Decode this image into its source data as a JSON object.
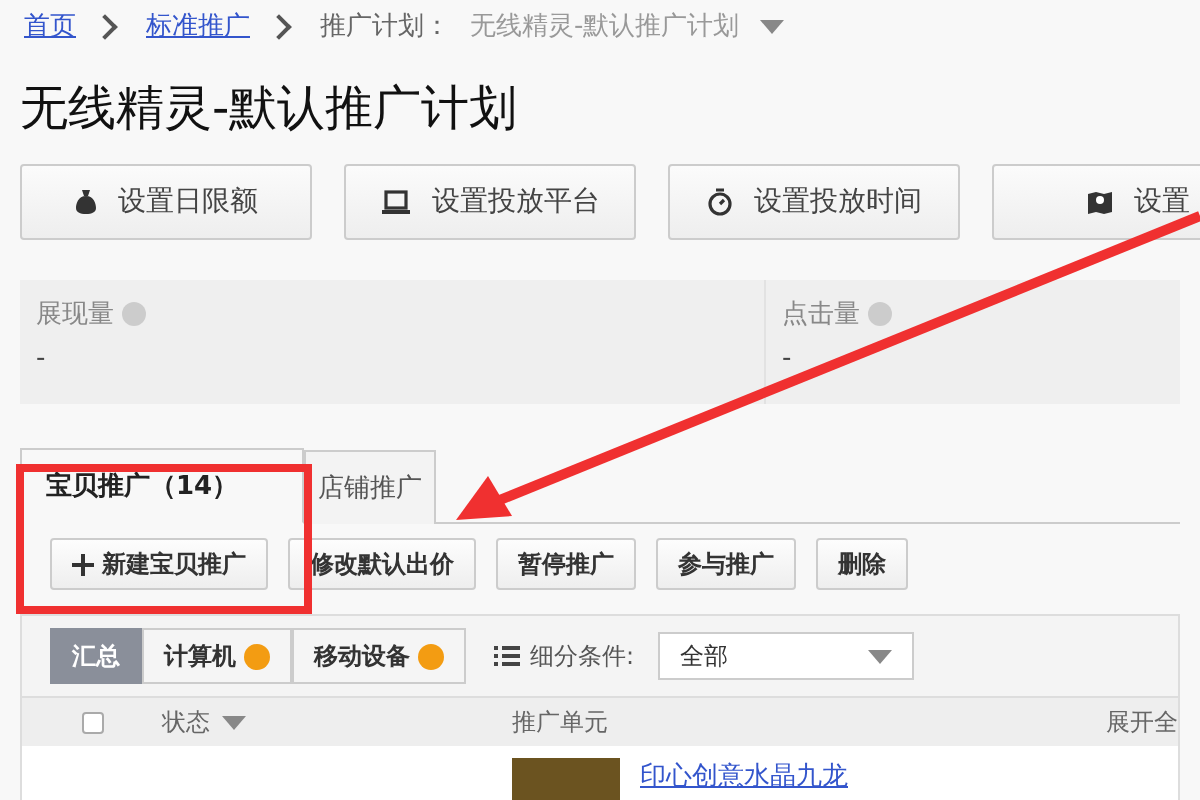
{
  "breadcrumb": [
    {
      "label": "首页",
      "kind": "link"
    },
    {
      "label": "标准推广",
      "kind": "link"
    },
    {
      "label": "推广计划：",
      "kind": "label"
    },
    {
      "label": "无线精灵-默认推广计划",
      "kind": "current"
    }
  ],
  "page_title": "无线精灵-默认推广计划",
  "toolbar": [
    {
      "label": "设置日限额",
      "kind": "budget"
    },
    {
      "label": "设置投放平台",
      "kind": "platform"
    },
    {
      "label": "设置投放时间",
      "kind": "time"
    },
    {
      "label": "设置",
      "kind": "region"
    }
  ],
  "stats": [
    {
      "label": "展现量",
      "value": "-"
    },
    {
      "label": "点击量",
      "value": "-"
    }
  ],
  "tabs": [
    {
      "label": "宝贝推广（14）",
      "selected": true
    },
    {
      "label": "店铺推广",
      "selected": false
    }
  ],
  "actions": [
    {
      "label": "新建宝贝推广",
      "kind": "add"
    },
    {
      "label": "修改默认出价",
      "kind": "plain"
    },
    {
      "label": "暂停推广",
      "kind": "plain"
    },
    {
      "label": "参与推广",
      "kind": "plain"
    },
    {
      "label": "删除",
      "kind": "plain"
    }
  ],
  "segments": [
    {
      "label": "汇总",
      "selected": true,
      "help": false
    },
    {
      "label": "计算机",
      "selected": false,
      "help": true
    },
    {
      "label": "移动设备",
      "selected": false,
      "help": true
    }
  ],
  "filter": {
    "label": "细分条件:",
    "value": "全部"
  },
  "table": {
    "select_all": {
      "checked": false
    },
    "columns": [
      "状态",
      "推广单元",
      "展开全"
    ],
    "rows": [
      {
        "title": "印心创意水晶九龙"
      }
    ]
  },
  "annotation": {
    "highlight": true,
    "arrow": true
  }
}
